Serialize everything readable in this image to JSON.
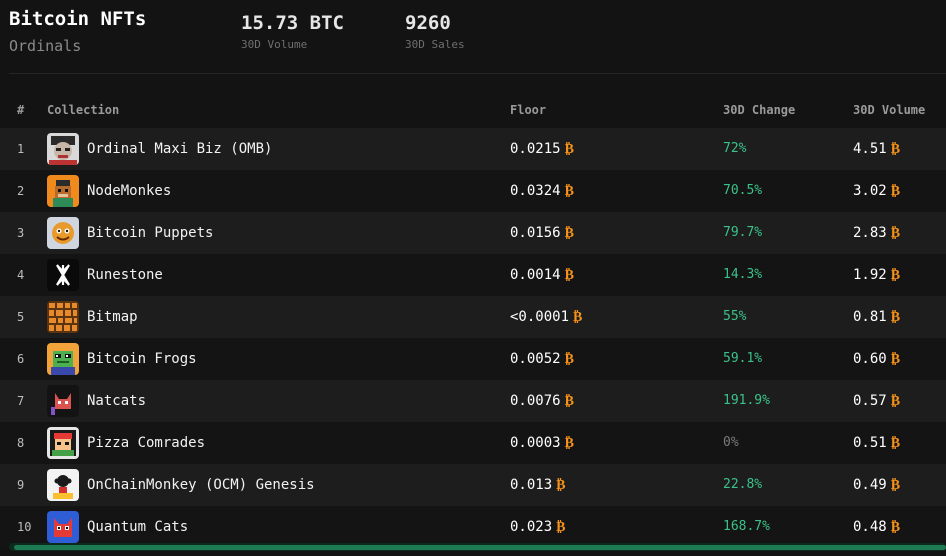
{
  "header": {
    "title": "Bitcoin NFTs",
    "subtitle": "Ordinals",
    "volume_value": "15.73 BTC",
    "volume_label": "30D Volume",
    "sales_value": "9260",
    "sales_label": "30D Sales"
  },
  "table": {
    "columns": [
      "#",
      "Collection",
      "Floor",
      "30D Change",
      "30D Volume"
    ],
    "btc_symbol": "₿",
    "rows": [
      {
        "rank": "1",
        "name": "Ordinal Maxi Biz (OMB)",
        "floor": "0.0215",
        "change": "72%",
        "volume": "4.51",
        "icon": "omb-avatar-icon"
      },
      {
        "rank": "2",
        "name": "NodeMonkes",
        "floor": "0.0324",
        "change": "70.5%",
        "volume": "3.02",
        "icon": "nodemonkes-avatar-icon"
      },
      {
        "rank": "3",
        "name": "Bitcoin Puppets",
        "floor": "0.0156",
        "change": "79.7%",
        "volume": "2.83",
        "icon": "bitcoin-puppets-avatar-icon"
      },
      {
        "rank": "4",
        "name": "Runestone",
        "floor": "0.0014",
        "change": "14.3%",
        "volume": "1.92",
        "icon": "runestone-avatar-icon"
      },
      {
        "rank": "5",
        "name": "Bitmap",
        "floor": "<0.0001",
        "change": "55%",
        "volume": "0.81",
        "icon": "bitmap-avatar-icon"
      },
      {
        "rank": "6",
        "name": "Bitcoin Frogs",
        "floor": "0.0052",
        "change": "59.1%",
        "volume": "0.60",
        "icon": "bitcoin-frogs-avatar-icon"
      },
      {
        "rank": "7",
        "name": "Natcats",
        "floor": "0.0076",
        "change": "191.9%",
        "volume": "0.57",
        "icon": "natcats-avatar-icon"
      },
      {
        "rank": "8",
        "name": "Pizza Comrades",
        "floor": "0.0003",
        "change": "0%",
        "volume": "0.51",
        "icon": "pizza-comrades-avatar-icon"
      },
      {
        "rank": "9",
        "name": "OnChainMonkey (OCM) Genesis",
        "floor": "0.013",
        "change": "22.8%",
        "volume": "0.49",
        "icon": "onchainmonkey-avatar-icon"
      },
      {
        "rank": "10",
        "name": "Quantum Cats",
        "floor": "0.023",
        "change": "168.7%",
        "volume": "0.48",
        "icon": "quantum-cats-avatar-icon"
      }
    ]
  },
  "colors": {
    "background": "#131313",
    "positive": "#3bc28a",
    "neutral": "#7a7a7a",
    "btc": "#f7931a"
  }
}
